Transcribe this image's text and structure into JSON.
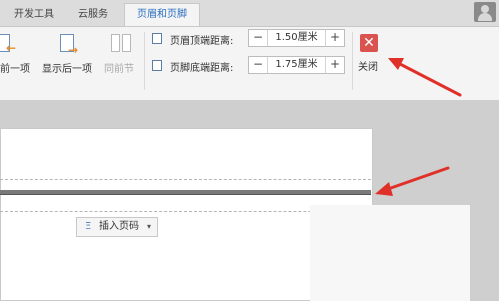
{
  "tabs": [
    "开发工具",
    "云服务",
    "页眉和页脚"
  ],
  "ribbon": {
    "prev_label": "前一项",
    "next_label": "显示后一项",
    "prev_section_label": "同前节",
    "header_distance_label": "页眉顶端距离:",
    "header_distance_value": "1.50厘米",
    "footer_distance_label": "页脚底端距离:",
    "footer_distance_value": "1.75厘米",
    "minus": "−",
    "plus": "+",
    "close_label": "关闭",
    "close_symbol": "✕"
  },
  "document": {
    "insert_page_number_label": "插入页码",
    "insert_icon": "Ξ",
    "dropdown_arrow": "▾"
  },
  "colors": {
    "accent_tab": "#2d6fc0",
    "close_red": "#d9534f",
    "annotation_arrow": "#e0302a"
  }
}
